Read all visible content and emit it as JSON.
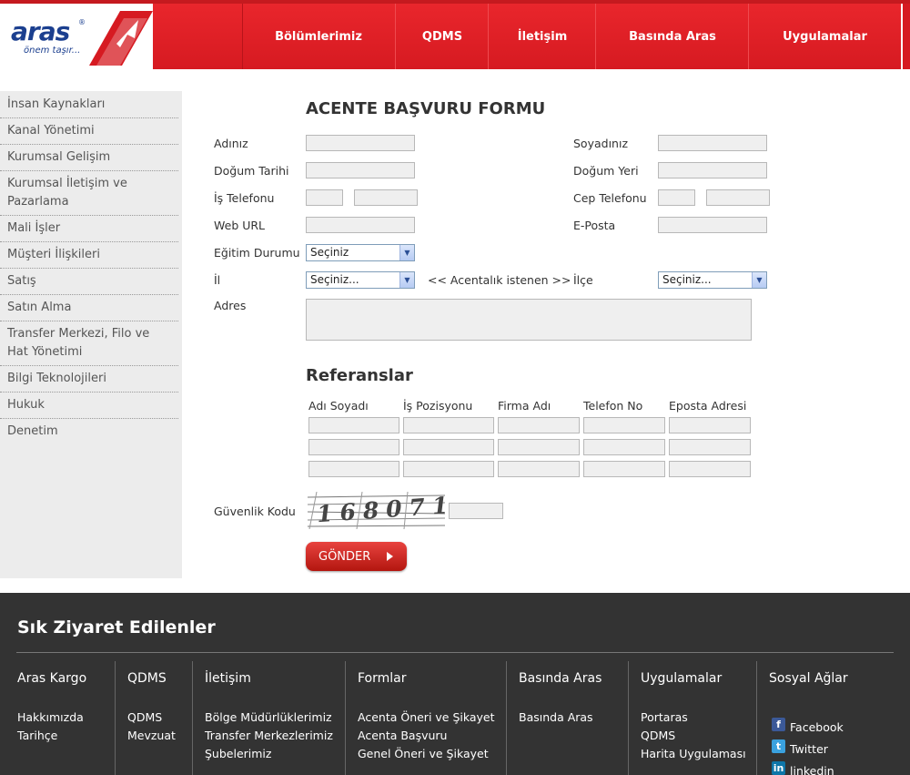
{
  "logo": {
    "text": "aras",
    "reg": "®",
    "slogan": "önem taşır..."
  },
  "nav": [
    "Bölümlerimiz",
    "QDMS",
    "İletişim",
    "Basında Aras",
    "Uygulamalar"
  ],
  "sidebar": [
    "İnsan Kaynakları",
    "Kanal Yönetimi",
    "Kurumsal Gelişim",
    "Kurumsal İletişim ve Pazarlama",
    "Mali İşler",
    "Müşteri İlişkileri",
    "Satış",
    "Satın Alma",
    "Transfer Merkezi, Filo ve Hat Yönetimi",
    "Bilgi Teknolojileri",
    "Hukuk",
    "Denetim"
  ],
  "form": {
    "title": "ACENTE BAŞVURU FORMU",
    "first_name": "Adınız",
    "last_name": "Soyadınız",
    "birth_date": "Doğum Tarihi",
    "birth_place": "Doğum Yeri",
    "work_phone": "İş Telefonu",
    "mobile_phone": "Cep Telefonu",
    "web_url": "Web URL",
    "email": "E-Posta",
    "education": "Eğitim Durumu",
    "education_value": "Seçiniz",
    "city": "İl",
    "city_value": "Seçiniz...",
    "agency_note": "<< Acentalık istenen >>",
    "district": "İlçe",
    "district_value": "Seçiniz...",
    "address": "Adres"
  },
  "references": {
    "title": "Referanslar",
    "columns": [
      "Adı Soyadı",
      "İş Pozisyonu",
      "Firma Adı",
      "Telefon No",
      "Eposta Adresi"
    ]
  },
  "security": {
    "label": "Güvenlik Kodu",
    "captcha_text": "168071"
  },
  "submit": "GÖNDER",
  "footer": {
    "title": "Sık Ziyaret Edilenler",
    "columns": [
      {
        "head": "Aras Kargo",
        "links": [
          "Hakkımızda",
          "Tarihçe"
        ]
      },
      {
        "head": "QDMS",
        "links": [
          "QDMS",
          "Mevzuat"
        ]
      },
      {
        "head": "İletişim",
        "links": [
          "Bölge Müdürlüklerimiz",
          "Transfer Merkezlerimiz",
          "Şubelerimiz"
        ]
      },
      {
        "head": "Formlar",
        "links": [
          "Acenta Öneri ve Şikayet",
          "Acenta Başvuru",
          "Genel Öneri ve Şikayet"
        ]
      },
      {
        "head": "Basında Aras",
        "links": [
          "Basında Aras"
        ]
      },
      {
        "head": "Uygulamalar",
        "links": [
          "Portaras",
          "QDMS",
          "Harita Uygulaması"
        ]
      },
      {
        "head": "Sosyal Ağlar",
        "links": [
          "Facebook",
          "Twitter",
          "linkedin"
        ]
      }
    ]
  },
  "colors": {
    "brand_red": "#d61a21",
    "brand_blue": "#1b3f8f",
    "footer_bg": "#333333"
  }
}
